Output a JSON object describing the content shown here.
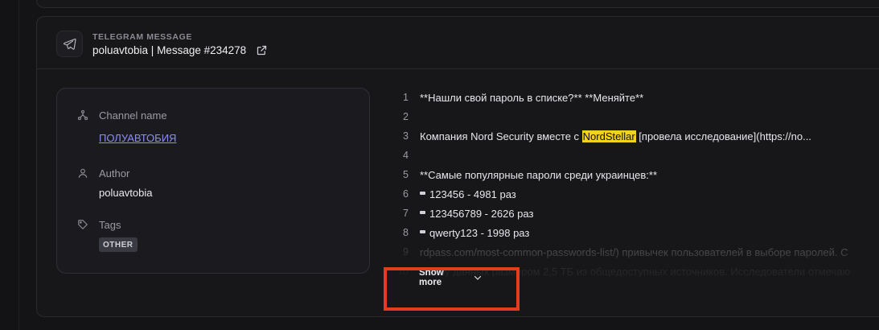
{
  "header": {
    "kind_label": "TELEGRAM MESSAGE",
    "title": "poluavtobia | Message #234278",
    "icon": "telegram-plane-icon",
    "external_icon": "external-link-icon"
  },
  "meta": {
    "channel_label": "Channel name",
    "channel_value": "ПОЛУАВТОБИЯ",
    "author_label": "Author",
    "author_value": "poluavtobia",
    "tags_label": "Tags",
    "tags": [
      "OTHER"
    ]
  },
  "code": {
    "lines": [
      {
        "n": "1",
        "text": "**Нашли свой пароль в списке?** **Меняйте**"
      },
      {
        "n": "2",
        "text": ""
      },
      {
        "n": "3",
        "pre": "Компания Nord Security вместе с ",
        "highlight": "NordStellar",
        "post": " [провела исследование](https://no..."
      },
      {
        "n": "4",
        "text": ""
      },
      {
        "n": "5",
        "text": "**Самые популярные пароли среди украинцев:**"
      },
      {
        "n": "6",
        "text": "123456 - 4981 раз"
      },
      {
        "n": "7",
        "text": "123456789 - 2626 раз"
      },
      {
        "n": "8",
        "text": "qwerty123 - 1998 раз"
      },
      {
        "n": "9",
        "text": "rdpass.com/most-common-passwords-list/) привычек пользователей в выборе паролей. С"
      },
      {
        "n": "10",
        "text": "и базу данных размером 2,5 ТБ из общедоступных источников. Исследователи отмечаю"
      }
    ]
  },
  "show_more_label": "Show more",
  "colors": {
    "accent_link": "#8d8df5",
    "highlight": "#f2d21b",
    "annotation_box": "#e33c1f"
  }
}
